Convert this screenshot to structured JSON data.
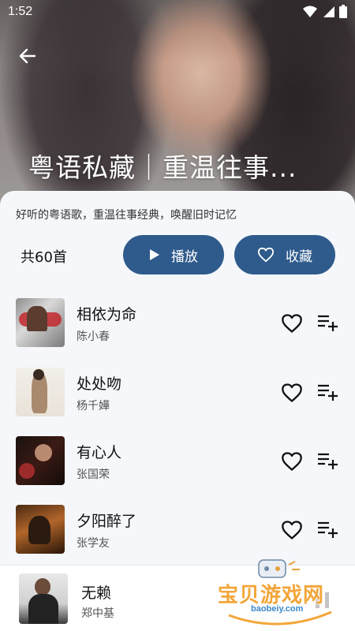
{
  "status": {
    "time": "1:52"
  },
  "playlist": {
    "title": "粤语私藏｜重温往事...",
    "description": "好听的粤语歌，重温往事经典，唤醒旧时记忆",
    "count": "共60首",
    "play_label": "播放",
    "fav_label": "收藏"
  },
  "songs": [
    {
      "title": "相依为命",
      "artist": "陈小春"
    },
    {
      "title": "处处吻",
      "artist": "杨千嬅"
    },
    {
      "title": "有心人",
      "artist": "张国荣"
    },
    {
      "title": "夕阳醉了",
      "artist": "张学友"
    }
  ],
  "player": {
    "title": "无赖",
    "artist": "郑中基"
  },
  "watermark": {
    "text": "宝贝游戏网",
    "url": "baobeiy.com"
  },
  "colors": {
    "accent": "#2f5b8c",
    "background": "#f5f7fb",
    "watermark": "#f3a63a"
  },
  "icons": [
    "back-arrow-icon",
    "wifi-icon",
    "signal-icon",
    "battery-icon",
    "play-icon",
    "heart-icon",
    "playlist-add-icon",
    "pause-icon"
  ]
}
